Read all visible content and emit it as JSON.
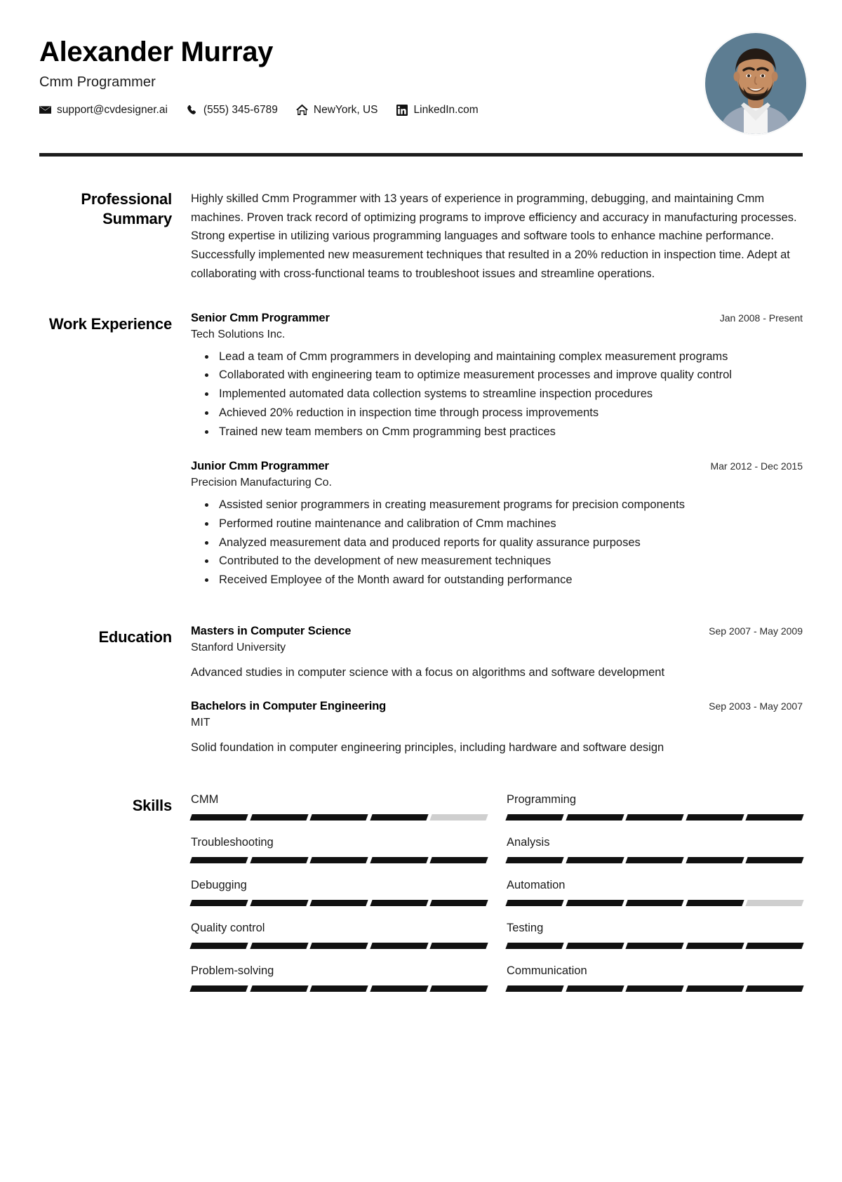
{
  "header": {
    "name": "Alexander Murray",
    "role": "Cmm Programmer",
    "contacts": [
      {
        "icon": "email-icon",
        "text": "support@cvdesigner.ai"
      },
      {
        "icon": "phone-icon",
        "text": "(555) 345-6789"
      },
      {
        "icon": "home-icon",
        "text": "NewYork, US"
      },
      {
        "icon": "linkedin-icon",
        "text": "LinkedIn.com"
      }
    ],
    "avatar_alt": "profile-photo"
  },
  "sections": {
    "summary": {
      "label": "Professional Summary",
      "text": "Highly skilled Cmm Programmer with 13 years of experience in programming, debugging, and maintaining Cmm machines. Proven track record of optimizing programs to improve efficiency and accuracy in manufacturing processes. Strong expertise in utilizing various programming languages and software tools to enhance machine performance. Successfully implemented new measurement techniques that resulted in a 20% reduction in inspection time. Adept at collaborating with cross-functional teams to troubleshoot issues and streamline operations."
    },
    "work": {
      "label": "Work Experience",
      "entries": [
        {
          "title": "Senior Cmm Programmer",
          "company": "Tech Solutions Inc.",
          "date": "Jan 2008 - Present",
          "bullets": [
            "Lead a team of Cmm programmers in developing and maintaining complex measurement programs",
            "Collaborated with engineering team to optimize measurement processes and improve quality control",
            "Implemented automated data collection systems to streamline inspection procedures",
            "Achieved 20% reduction in inspection time through process improvements",
            "Trained new team members on Cmm programming best practices"
          ]
        },
        {
          "title": "Junior Cmm Programmer",
          "company": "Precision Manufacturing Co.",
          "date": "Mar 2012 - Dec 2015",
          "bullets": [
            "Assisted senior programmers in creating measurement programs for precision components",
            "Performed routine maintenance and calibration of Cmm machines",
            "Analyzed measurement data and produced reports for quality assurance purposes",
            "Contributed to the development of new measurement techniques",
            "Received Employee of the Month award for outstanding performance"
          ]
        }
      ]
    },
    "education": {
      "label": "Education",
      "entries": [
        {
          "degree": "Masters in Computer Science",
          "school": "Stanford University",
          "date": "Sep 2007 - May 2009",
          "description": "Advanced studies in computer science with a focus on algorithms and software development"
        },
        {
          "degree": "Bachelors in Computer Engineering",
          "school": "MIT",
          "date": "Sep 2003 - May 2007",
          "description": "Solid foundation in computer engineering principles, including hardware and software design"
        }
      ]
    },
    "skills": {
      "label": "Skills",
      "segments_total": 5,
      "items": [
        {
          "name": "CMM",
          "filled": 4
        },
        {
          "name": "Programming",
          "filled": 5
        },
        {
          "name": "Troubleshooting",
          "filled": 5
        },
        {
          "name": "Analysis",
          "filled": 5
        },
        {
          "name": "Debugging",
          "filled": 5
        },
        {
          "name": "Automation",
          "filled": 4
        },
        {
          "name": "Quality control",
          "filled": 5
        },
        {
          "name": "Testing",
          "filled": 5
        },
        {
          "name": "Problem-solving",
          "filled": 5
        },
        {
          "name": "Communication",
          "filled": 5
        }
      ]
    }
  },
  "colors": {
    "text": "#111111",
    "rule": "#1d1d1d",
    "skill_filled": "#111111",
    "skill_empty": "#cfcfcf"
  }
}
